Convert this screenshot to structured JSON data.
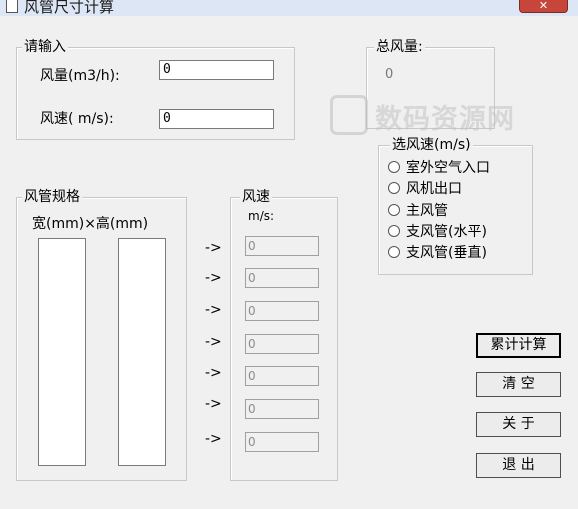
{
  "window": {
    "title": "风管尺寸计算",
    "close_glyph": "✕"
  },
  "input_group": {
    "legend": "请输入",
    "airflow_label": "风量(m3/h):",
    "airflow_value": "0",
    "speed_label": "风速( m/s):",
    "speed_value": "0"
  },
  "total_group": {
    "legend": "总风量:",
    "value": "0"
  },
  "watermark": {
    "text": "数码资源网"
  },
  "speed_select": {
    "legend": "选风速(m/s)",
    "options": [
      "室外空气入口",
      "风机出口",
      "主风管",
      "支风管(水平)",
      "支风管(垂直)"
    ]
  },
  "spec_group": {
    "legend": "风管规格",
    "header": "宽(mm)×高(mm)"
  },
  "speed_group": {
    "legend": "风速",
    "unit": "m/s:",
    "arrow": "->",
    "values": [
      "0",
      "0",
      "0",
      "0",
      "0",
      "0",
      "0"
    ]
  },
  "buttons": {
    "calc": "累计计算",
    "clear": "清  空",
    "about": "关  于",
    "exit": "退  出"
  },
  "colors": {
    "close": "#c7463b",
    "titlebar": "#dce6f4",
    "window": "#f0f0f0"
  }
}
